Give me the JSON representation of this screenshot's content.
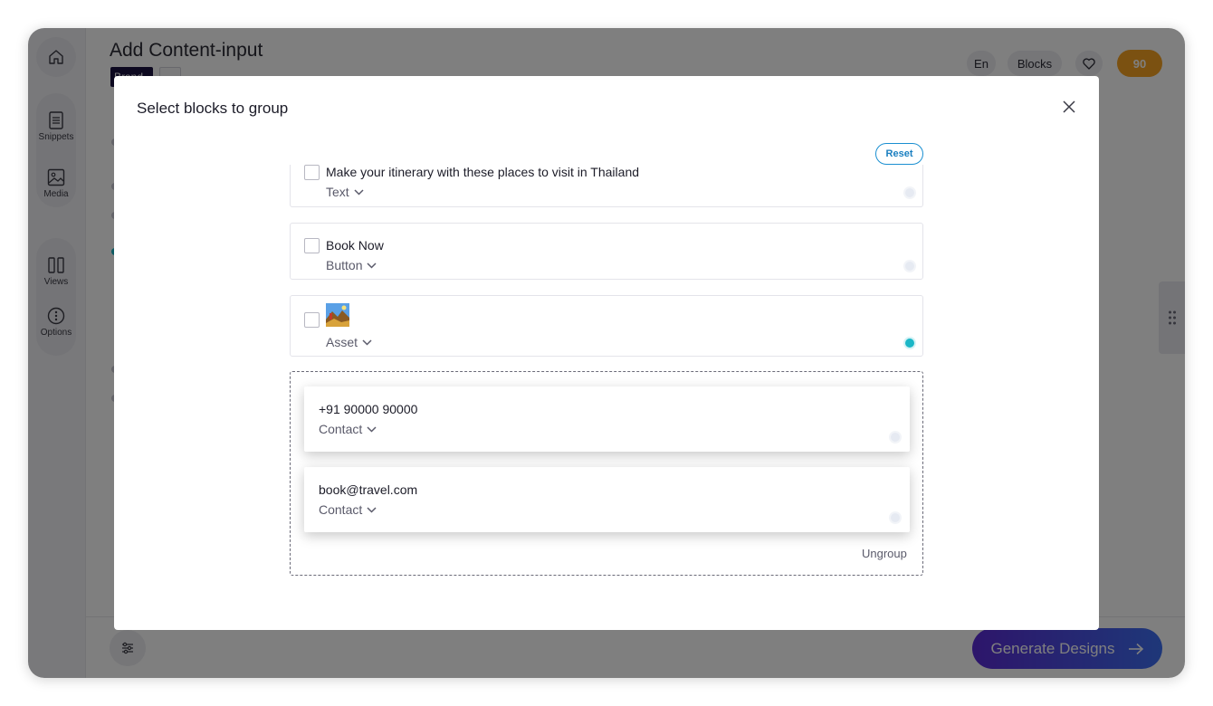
{
  "background": {
    "title": "Add Content-input",
    "tag_label": "Brand",
    "language": "En",
    "blocks_label": "Blocks",
    "credits": "90",
    "generate_label": "Generate Designs",
    "sidebar": [
      {
        "label": "Snippets",
        "icon": "document-icon"
      },
      {
        "label": "Media",
        "icon": "image-icon"
      },
      {
        "label": "Views",
        "icon": "columns-icon"
      },
      {
        "label": "Options",
        "icon": "options-icon"
      }
    ]
  },
  "modal": {
    "title": "Select blocks to group",
    "reset_label": "Reset",
    "blocks": [
      {
        "text": "Make your itinerary with these places to visit in Thailand",
        "type": "Text",
        "active": false
      },
      {
        "text": "Book Now",
        "type": "Button",
        "active": false
      },
      {
        "text": "",
        "type": "Asset",
        "active": true,
        "icon": "landscape-thumbnail-icon"
      }
    ],
    "group": {
      "items": [
        {
          "text": "+91 90000 90000",
          "type": "Contact"
        },
        {
          "text": "book@travel.com",
          "type": "Contact"
        }
      ],
      "ungroup_label": "Ungroup"
    }
  },
  "colors": {
    "accent": "#1bb7c7",
    "reset_border": "#1a8fd1",
    "credits": "#f6a323",
    "generate_start": "#5b2bd6",
    "generate_end": "#3d6ff2"
  }
}
